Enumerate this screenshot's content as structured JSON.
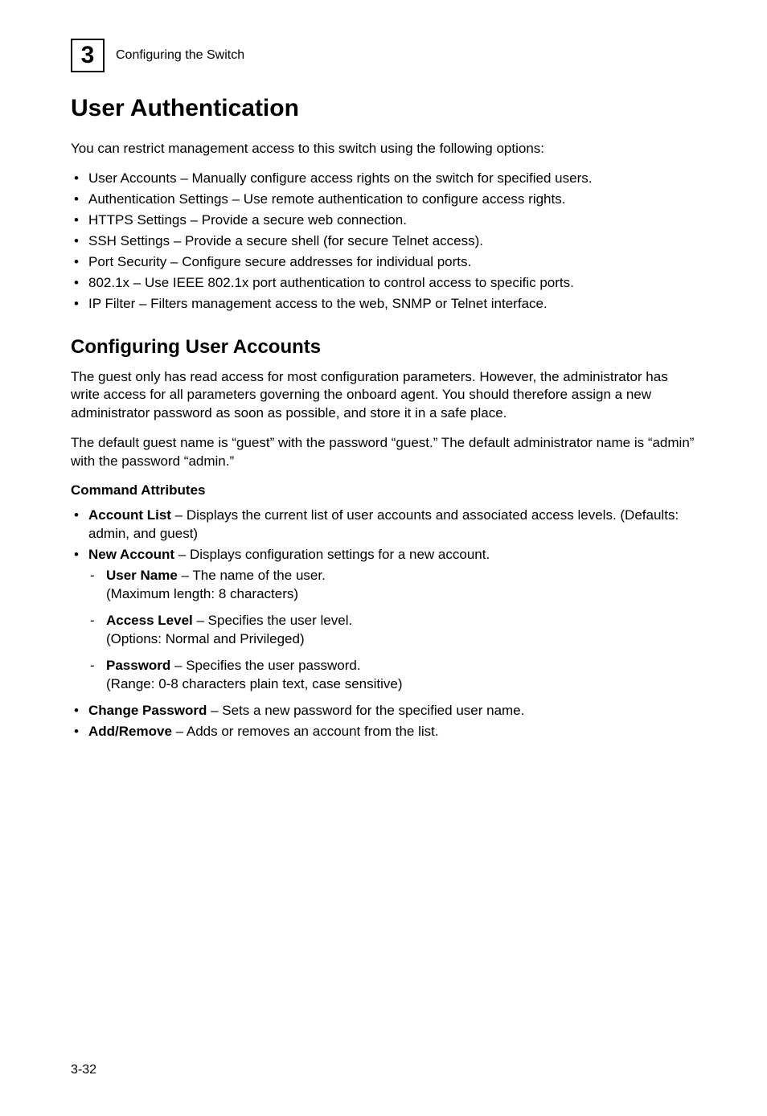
{
  "header": {
    "chapter_number": "3",
    "chapter_label": "Configuring the Switch"
  },
  "main_title": "User Authentication",
  "intro": "You can restrict management access to this switch using the following options:",
  "options": [
    "User Accounts – Manually configure access rights on the switch for specified users.",
    "Authentication Settings – Use remote authentication to configure access rights.",
    "HTTPS Settings – Provide a secure web connection.",
    "SSH Settings – Provide a secure shell (for secure Telnet access).",
    "Port Security – Configure secure addresses for individual ports.",
    "802.1x – Use IEEE 802.1x port authentication to control access to specific ports.",
    "IP Filter – Filters management access to the web, SNMP or Telnet interface."
  ],
  "section_title": "Configuring User Accounts",
  "section_para1": "The guest only has read access for most configuration parameters. However, the administrator has write access for all parameters governing the onboard agent. You should therefore assign a new administrator password as soon as possible, and store it in a safe place.",
  "section_para2": "The default guest name is “guest” with the password “guest.” The default administrator name is “admin” with the password “admin.”",
  "cmd_attr_heading": "Command Attributes",
  "attrs": {
    "account_list": {
      "label": "Account List",
      "desc": " – Displays the current list of user accounts and associated access levels. (Defaults: admin, and guest)"
    },
    "new_account": {
      "label": "New Account",
      "desc": " – Displays configuration settings for a new account."
    },
    "user_name": {
      "label": "User Name",
      "desc": " – The name of the user.",
      "note": "(Maximum length: 8 characters)"
    },
    "access_level": {
      "label": "Access Level",
      "desc": " – Specifies the user level.",
      "note": "(Options: Normal and Privileged)"
    },
    "password": {
      "label": "Password",
      "desc": " – Specifies the user password.",
      "note": "(Range: 0-8 characters plain text, case sensitive)"
    },
    "change_password": {
      "label": "Change Password",
      "desc": " – Sets a new password for the specified user name."
    },
    "add_remove": {
      "label": "Add/Remove",
      "desc": " – Adds or removes an account from the list."
    }
  },
  "page_number": "3-32"
}
